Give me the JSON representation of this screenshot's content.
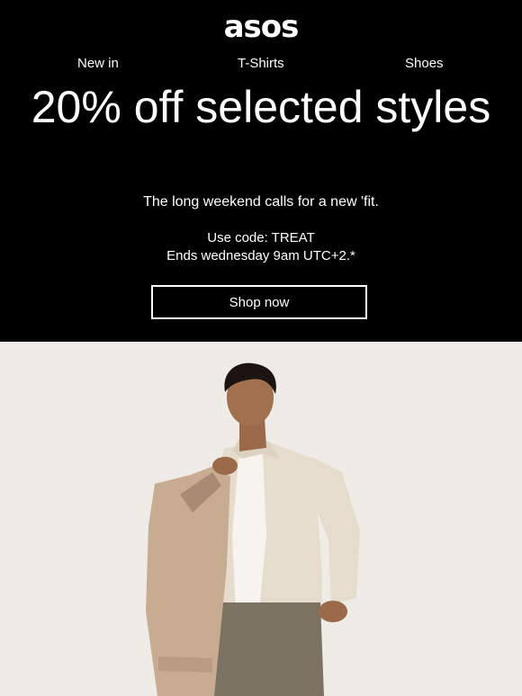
{
  "brand": {
    "logo": "asos"
  },
  "nav": {
    "items": [
      "New in",
      "T-Shirts",
      "Shoes"
    ]
  },
  "hero": {
    "headline": "20% off selected styles",
    "subheading": "The long weekend calls for a new 'fit.",
    "code_line": "Use code: TREAT",
    "ends_line": "Ends wednesday 9am UTC+2.*",
    "cta_label": "Shop now"
  },
  "colors": {
    "hero_bg": "#000000",
    "text": "#ffffff",
    "photo_bg": "#efebe7",
    "shirt": "#e6dccd",
    "jacket": "#c8ac92",
    "skin": "#a0704f"
  },
  "photo": {
    "subject": "model-in-linen-shirt"
  }
}
